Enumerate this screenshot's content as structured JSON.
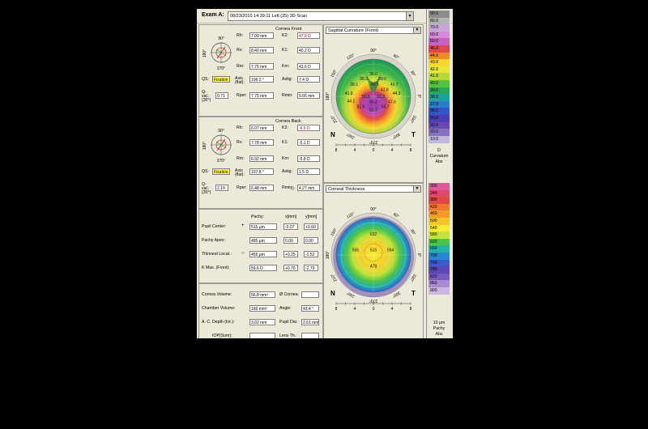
{
  "exam": {
    "label": "Exam A:",
    "value": "08/23/2010  14:39:11   Left    (25) 3D-Scan"
  },
  "front": {
    "title": "Cornea Front",
    "orientation": {
      "top": "90°",
      "left": "180°",
      "bottom": "270°"
    },
    "rows": [
      {
        "l1": "Rh:",
        "v1": "7.09 mm",
        "l2": "K2:",
        "v2": "47.6 D",
        "red2": true
      },
      {
        "l1": "Rv:",
        "v1": "8.40 mm",
        "l2": "K1:",
        "v2": "40.2 D"
      },
      {
        "l1": "Rm:",
        "v1": "7.75 mm",
        "l2": "Km:",
        "v2": "43.6 D"
      },
      {
        "l1": "Axis (flat):",
        "v1": "106.2 °",
        "l2": "Astig:",
        "v2": "7.4 D"
      },
      {
        "l1": "Rper:",
        "v1": "7.75 mm",
        "l2": "Rmin:",
        "v2": "5.66 mm"
      }
    ],
    "qs_label": "QS:",
    "qs_value": "Fixation",
    "qval_label": "Q-val.: (30°)",
    "qval_value": "0.71"
  },
  "back": {
    "title": "Cornea Back",
    "orientation": {
      "top": "90°",
      "left": "180°",
      "bottom": "270°"
    },
    "rows": [
      {
        "l1": "Rh:",
        "v1": "6.07 mm",
        "l2": "K2:",
        "v2": "-6.6 D",
        "red2": true
      },
      {
        "l1": "Rv:",
        "v1": "7.78 mm",
        "l2": "K1:",
        "v2": "-5.1 D"
      },
      {
        "l1": "Rm:",
        "v1": "6.92 mm",
        "l2": "Km:",
        "v2": "-5.8 D"
      },
      {
        "l1": "Axis (flat):",
        "v1": "107.8 °",
        "l2": "Astig:",
        "v2": "1.5 D"
      },
      {
        "l1": "Rper:",
        "v1": "6.48 mm",
        "l2": "Rmin:",
        "v2": "4.27 mm"
      }
    ],
    "qs_label": "QS:",
    "qs_value": "Fixation",
    "qval_label": "Q-val.: (30°)",
    "qval_value": "2.19"
  },
  "pachy": {
    "col_pachy": "Pachy:",
    "col_x": "x[mm]",
    "col_y": "y[mm]",
    "rows": [
      {
        "label": "Pupil Center:",
        "sym": "+",
        "pachy": "515 µm",
        "x": "-0.07",
        "y": "+0.60"
      },
      {
        "label": "Pachy Apex:",
        "sym": "",
        "pachy": "495 µm",
        "x": "0.00",
        "y": "0.00"
      },
      {
        "label": "Thinnest Locat.:",
        "sym": "○",
        "pachy": "455 µm",
        "x": "+0.25",
        "y": "-1.52"
      },
      {
        "label": "K Max. (Front):",
        "sym": "",
        "pachy": "59.6 D",
        "x": "+0.76",
        "y": "-2.79"
      }
    ]
  },
  "volume": {
    "cornea_volume_label": "Cornea Volume:",
    "cornea_volume": "56.8 mm³",
    "o_cornea_label": "Ø Cornea:",
    "o_cornea": "",
    "chamber_volume_label": "Chamber Volume:",
    "chamber_volume": "166 mm³",
    "angle_label": "Angle:",
    "angle": "43.4 °",
    "acd_label": "A. C. Depth (Int.):",
    "acd": "3.02 mm",
    "pupil_dia_label": "Pupil Dia:",
    "pupil_dia": "2.61 mm",
    "iop_label": "IOP(Sum):",
    "iop": "",
    "lens_th_label": "Lens Th.:",
    "lens_th": ""
  },
  "sagittal_map": {
    "title": "Sagittal Curvature (Front)",
    "angles": [
      "90°",
      "120°",
      "60°",
      "150°",
      "30°",
      "180°",
      "0°",
      "210°",
      "330°",
      "240°",
      "300°",
      "270°"
    ],
    "nasal": "N",
    "temporal": "T",
    "axis_ticks": [
      "8",
      "4",
      "0",
      "4",
      "8"
    ],
    "values": [
      {
        "v": "38.3",
        "fx": 0.37,
        "fy": 0.28
      },
      {
        "v": "39.6",
        "fx": 0.62,
        "fy": 0.28
      },
      {
        "v": "36.6",
        "fx": 0.5,
        "fy": 0.22
      },
      {
        "v": "40.5",
        "fx": 0.52,
        "fy": 0.36
      },
      {
        "v": "39.1",
        "fx": 0.24,
        "fy": 0.36
      },
      {
        "v": "41.7",
        "fx": 0.78,
        "fy": 0.36
      },
      {
        "v": "42.8",
        "fx": 0.65,
        "fy": 0.43
      },
      {
        "v": "41.5",
        "fx": 0.17,
        "fy": 0.48
      },
      {
        "v": "44.3",
        "fx": 0.81,
        "fy": 0.48
      },
      {
        "v": "50.8",
        "fx": 0.4,
        "fy": 0.52
      },
      {
        "v": "52.3",
        "fx": 0.6,
        "fy": 0.52
      },
      {
        "v": "44.1",
        "fx": 0.2,
        "fy": 0.58
      },
      {
        "v": "55.2",
        "fx": 0.5,
        "fy": 0.59
      },
      {
        "v": "47.6",
        "fx": 0.75,
        "fy": 0.59
      },
      {
        "v": "51.6",
        "fx": 0.33,
        "fy": 0.66
      },
      {
        "v": "53.7",
        "fx": 0.66,
        "fy": 0.66
      },
      {
        "v": "51.7",
        "fx": 0.5,
        "fy": 0.7
      }
    ]
  },
  "thickness_map": {
    "title": "Corneal Thickness",
    "angles": [
      "90°",
      "120°",
      "60°",
      "150°",
      "30°",
      "180°",
      "0°",
      "210°",
      "330°",
      "240°",
      "300°",
      "270°"
    ],
    "nasal": "N",
    "temporal": "T",
    "axis_ticks": [
      "8",
      "4",
      "0",
      "4",
      "8"
    ],
    "values": [
      {
        "v": "632",
        "fx": 0.5,
        "fy": 0.24
      },
      {
        "v": "555",
        "fx": 0.26,
        "fy": 0.45
      },
      {
        "v": "515",
        "fx": 0.5,
        "fy": 0.45
      },
      {
        "v": "564",
        "fx": 0.73,
        "fy": 0.45
      },
      {
        "v": "478",
        "fx": 0.5,
        "fy": 0.67
      }
    ]
  },
  "curvature_scale": {
    "unit": "D",
    "label1": "Curvature",
    "label2": "Abs",
    "steps": [
      {
        "v": "90.0",
        "c": "#8c8c8c"
      },
      {
        "v": "80.0",
        "c": "#b4b4b4"
      },
      {
        "v": "70.0",
        "c": "#c9a4d6"
      },
      {
        "v": "60.0",
        "c": "#d98ad8"
      },
      {
        "v": "50.0",
        "c": "#c761c2"
      },
      {
        "v": "46.0",
        "c": "#e0484a"
      },
      {
        "v": "44.0",
        "c": "#ef8b2a"
      },
      {
        "v": "43.0",
        "c": "#f8d52e"
      },
      {
        "v": "42.0",
        "c": "#e6e63a"
      },
      {
        "v": "41.0",
        "c": "#b8d93a"
      },
      {
        "v": "40.0",
        "c": "#55c23c"
      },
      {
        "v": "39.0",
        "c": "#2aa85a"
      },
      {
        "v": "38.0",
        "c": "#22a0a0"
      },
      {
        "v": "37.0",
        "c": "#2c7ecb"
      },
      {
        "v": "36.0",
        "c": "#3256c8"
      },
      {
        "v": "35.0",
        "c": "#4a3fb4"
      },
      {
        "v": "30.0",
        "c": "#6a4ab0"
      },
      {
        "v": "20.0",
        "c": "#8a70c0"
      },
      {
        "v": "10.0",
        "c": "#bfb7dc"
      }
    ]
  },
  "pachy_scale": {
    "unit": "10 µm",
    "label1": "Pachy",
    "label2": "Abs",
    "steps": [
      {
        "v": "300",
        "c": "#e05a9a"
      },
      {
        "v": "340",
        "c": "#e04a6a"
      },
      {
        "v": "380",
        "c": "#e04848"
      },
      {
        "v": "420",
        "c": "#ee7a30"
      },
      {
        "v": "460",
        "c": "#f39a2b"
      },
      {
        "v": "500",
        "c": "#f5c52c"
      },
      {
        "v": "540",
        "c": "#f6ea34"
      },
      {
        "v": "580",
        "c": "#c6e23b"
      },
      {
        "v": "620",
        "c": "#4fc24a"
      },
      {
        "v": "660",
        "c": "#25b2a6"
      },
      {
        "v": "700",
        "c": "#2a86d0"
      },
      {
        "v": "740",
        "c": "#3a5bc8"
      },
      {
        "v": "780",
        "c": "#5b47b8"
      },
      {
        "v": "820",
        "c": "#7a5ac0"
      },
      {
        "v": "860",
        "c": "#a78ad0"
      },
      {
        "v": "900",
        "c": "#cdb7e2"
      }
    ]
  }
}
